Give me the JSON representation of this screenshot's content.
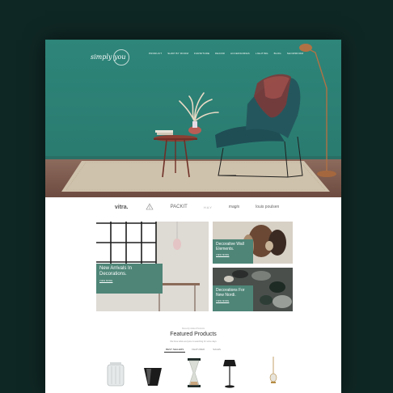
{
  "header": {
    "logo_text": "simply you",
    "nav": [
      "PRODUCT",
      "SHOP BY ROOM",
      "FURNITURE",
      "DECOR",
      "ACCESSORIES",
      "LIGHTING",
      "BLOG",
      "SHOWROOM"
    ]
  },
  "brands": [
    "vitra.",
    "PACKIT",
    "HAY",
    "magis",
    "louis poulsen"
  ],
  "promos": {
    "big": {
      "title": "New Arrivals In Decorations.",
      "link": "VIEW MORE"
    },
    "top_right": {
      "title": "Decorative Wall Elements.",
      "link": "VIEW MORE"
    },
    "bottom_right": {
      "title": "Decorations For New Nordi.",
      "link": "VIEW MORE"
    }
  },
  "featured": {
    "eyebrow": "Recently Added Products",
    "title": "Featured Products",
    "subtitle": "We have what everyone is searching for some days",
    "tabs": [
      "BEST SELLERS",
      "FEATURED",
      "SALES"
    ],
    "active_tab": 0
  },
  "products": [
    {
      "icon": "glass-jar-icon"
    },
    {
      "icon": "black-vase-icon"
    },
    {
      "icon": "hourglass-icon"
    },
    {
      "icon": "black-table-lamp-icon"
    },
    {
      "icon": "brass-wall-lamp-icon"
    }
  ],
  "colors": {
    "background": "#0f2724",
    "hero_wall": "#2e8579",
    "label_teal": "#4e8577"
  }
}
